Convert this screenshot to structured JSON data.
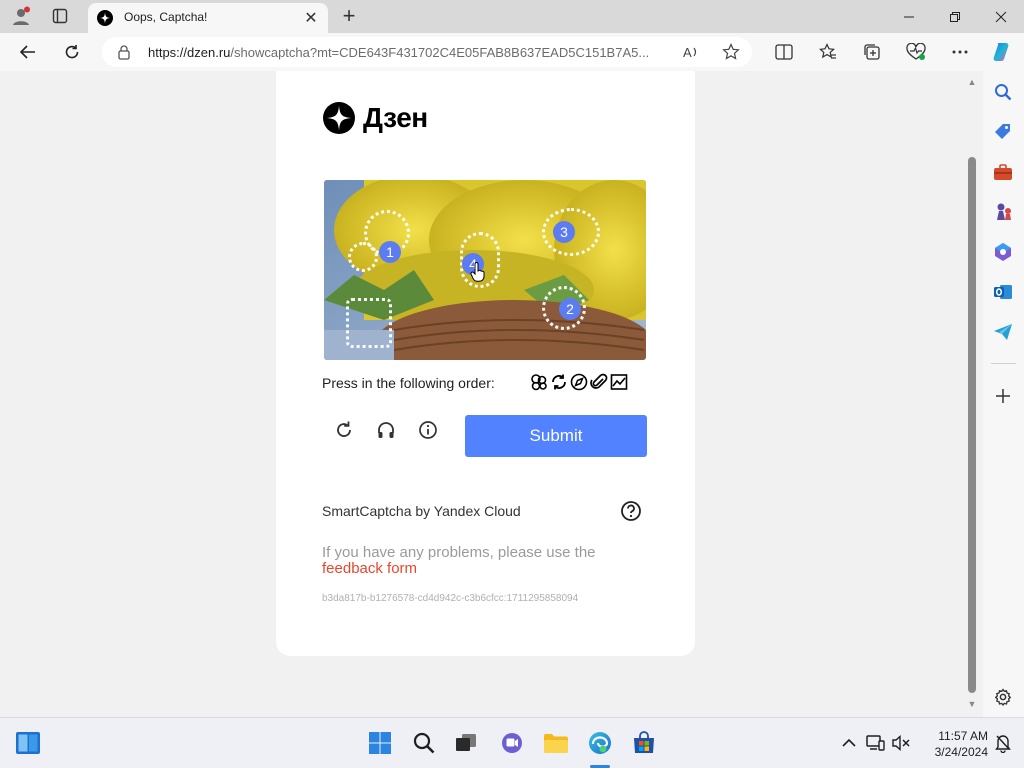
{
  "browser": {
    "tab_title": "Oops, Captcha!",
    "url_host": "https://dzen.ru",
    "url_path": "/showcaptcha?mt=CDE643F431702C4E05FAB8B637EAD5C151B7A5..."
  },
  "page": {
    "logo_text": "Дзен",
    "instruction": "Press in the following order:",
    "submit_label": "Submit",
    "brand_text": "SmartCaptcha by Yandex Cloud",
    "problems_text": "If you have any problems, please use the",
    "feedback_link": "feedback form",
    "token": "b3da817b-b1276578-cd4d942c-c3b6cfcc:1711295858094",
    "markers": [
      "1",
      "2",
      "3",
      "4"
    ]
  },
  "taskbar": {
    "time": "11:57 AM",
    "date": "3/24/2024"
  },
  "colors": {
    "accent": "#5282ff",
    "marker": "#5b7cf2",
    "link": "#e7472d"
  }
}
